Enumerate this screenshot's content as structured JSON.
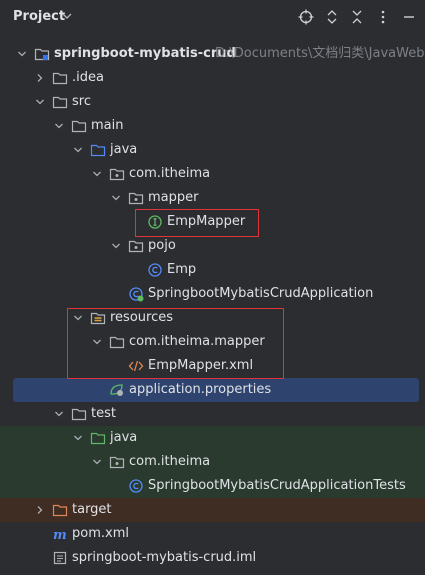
{
  "header": {
    "title": "Project"
  },
  "tree": {
    "root": {
      "name": "springboot-mybatis-crud",
      "path": "D:\\Documents\\文档归类\\JavaWeb"
    },
    "idea": ".idea",
    "src": "src",
    "main": "main",
    "java": "java",
    "pkg": "com.itheima",
    "mapper": "mapper",
    "empmapper": "EmpMapper",
    "pojo": "pojo",
    "emp": "Emp",
    "app": "SpringbootMybatisCrudApplication",
    "resources": "resources",
    "res_pkg": "com.itheima.mapper",
    "empmapper_xml": "EmpMapper.xml",
    "props": "application.properties",
    "test": "test",
    "test_java": "java",
    "test_pkg": "com.itheima",
    "tests": "SpringbootMybatisCrudApplicationTests",
    "target": "target",
    "pom": "pom.xml",
    "iml": "springboot-mybatis-crud.iml"
  },
  "colors": {
    "selection": "#2e436e",
    "test_band": "#2a3a2f",
    "excluded_band": "#3f2d24",
    "highlight_box": "#e0343a"
  }
}
